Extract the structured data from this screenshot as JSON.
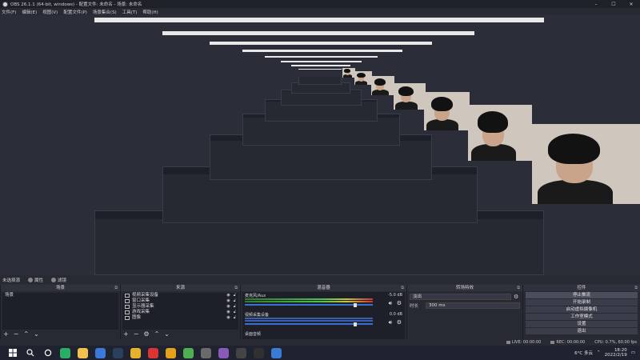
{
  "window": {
    "title": "OBS 26.1.1 (64-bit, windows) - 配置文件: 未命名 - 场景: 未命名",
    "controls": [
      "–",
      "☐",
      "✕"
    ]
  },
  "menu": [
    "文件(F)",
    "编辑(E)",
    "视图(V)",
    "配置文件(P)",
    "场景集合(S)",
    "工具(T)",
    "帮助(H)"
  ],
  "scene_bar": {
    "current": "未选择源",
    "properties": "属性",
    "filters": "滤镜"
  },
  "scenes": {
    "title": "场景",
    "items": [
      "场景"
    ]
  },
  "sources": {
    "title": "来源",
    "items": [
      "视频采集设备",
      "窗口采集",
      "显示器采集",
      "游戏采集",
      "图像"
    ]
  },
  "mixer": {
    "title": "混音器",
    "channels": [
      {
        "name": "麦克风/Aux",
        "db": "-5.0 dB",
        "level": 0.9,
        "volume": 0.85
      },
      {
        "name": "视频采集设备",
        "db": "0.0 dB",
        "level": 0.0,
        "volume": 0.85
      },
      {
        "name": "桌面音频",
        "db": "",
        "level": 0.0,
        "volume": 0.0
      }
    ]
  },
  "transitions": {
    "title": "转场特效",
    "type": "淡出",
    "duration_label": "时长",
    "duration": "300 ms"
  },
  "controls": {
    "title": "控件",
    "buttons": [
      "停止推流",
      "开始录制",
      "启动虚拟摄像机",
      "工作室模式",
      "设置",
      "退出"
    ]
  },
  "statusbar": {
    "live": "LIVE: 00:00:00",
    "rec": "REC: 00:00:00",
    "cpu": "CPU: 0.7%, 60.00 fps"
  },
  "taskbar": {
    "weather": "6°C  多云",
    "time": "18:20",
    "date": "2022/2/19",
    "icons": [
      {
        "name": "windows-start-icon",
        "color": "#ffffff"
      },
      {
        "name": "search-icon",
        "color": "#ffffff"
      },
      {
        "name": "task-view-icon",
        "color": "#ffffff"
      },
      {
        "name": "wechat-icon",
        "color": "#2aae67"
      },
      {
        "name": "file-explorer-icon",
        "color": "#f2c24f"
      },
      {
        "name": "mail-icon",
        "color": "#3b78d8"
      },
      {
        "name": "steam-icon",
        "color": "#2a3f5a"
      },
      {
        "name": "chrome-icon",
        "color": "#e6b12d"
      },
      {
        "name": "netease-icon",
        "color": "#d33"
      },
      {
        "name": "shield-icon",
        "color": "#e3a21a"
      },
      {
        "name": "green-app-icon",
        "color": "#4caf50"
      },
      {
        "name": "app-icon-1",
        "color": "#6a6a6a"
      },
      {
        "name": "app-icon-2",
        "color": "#8a5ab8"
      },
      {
        "name": "app-icon-3",
        "color": "#444"
      },
      {
        "name": "obs-icon",
        "color": "#303030"
      },
      {
        "name": "app-icon-4",
        "color": "#3a7bd5"
      }
    ]
  }
}
